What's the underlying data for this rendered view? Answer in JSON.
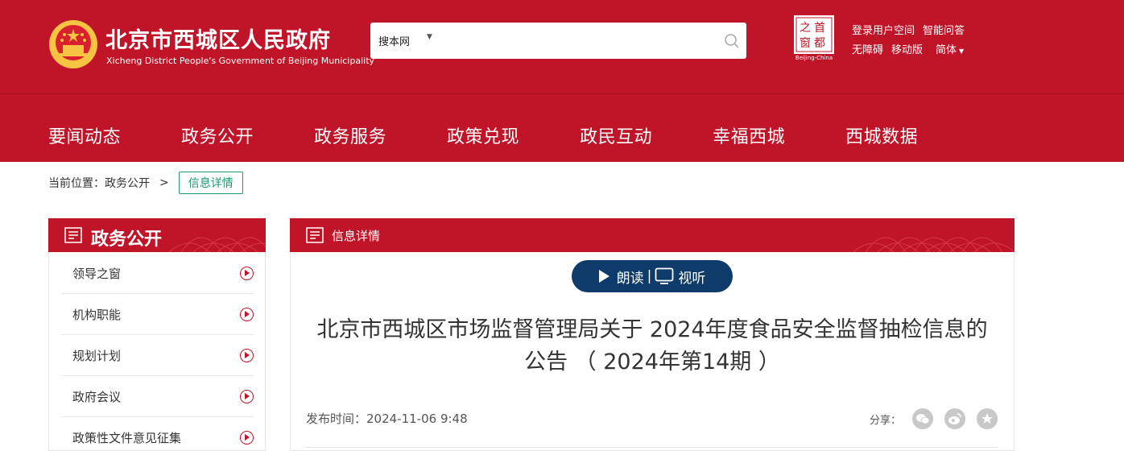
{
  "header": {
    "title": "北京市西城区人民政府",
    "subtitle": "Xicheng District People's Government of Beijing Municipality",
    "capital_logo_text": "Beijing-China",
    "capital_logo_chars": [
      "首",
      "之",
      "都",
      "窗"
    ],
    "search": {
      "scope": "搜本网",
      "placeholder": ""
    },
    "links_row1": [
      "登录用户空间",
      "智能问答"
    ],
    "links_row2": [
      "无障碍",
      "移动版",
      "简体"
    ],
    "nav": [
      "要闻动态",
      "政务公开",
      "政务服务",
      "政策兑现",
      "政民互动",
      "幸福西城",
      "西城数据"
    ]
  },
  "breadcrumb": {
    "prefix": "当前位置：政务公开",
    "separator": ">",
    "current": "信息详情"
  },
  "sidebar": {
    "title": "政务公开",
    "items": [
      "领导之窗",
      "机构职能",
      "规划计划",
      "政府会议",
      "政策性文件意见征集"
    ]
  },
  "main": {
    "header": "信息详情",
    "listen_label": "朗读",
    "pill_separator": "|",
    "watch_label": "视听",
    "title_line1": "北京市西城区市场监督管理局关于 2024年度食品安全监督抽检信息的",
    "title_line2": "公告 （ 2024年第14期 ）",
    "publish_label": "发布时间：2024-11-06 9:48",
    "share_label": "分享："
  },
  "colors": {
    "brand_red": "#c01428",
    "pill_navy": "#0e3b69",
    "breadcrumb_green": "#1a9b74",
    "emblem_gold": "#f6c342"
  }
}
